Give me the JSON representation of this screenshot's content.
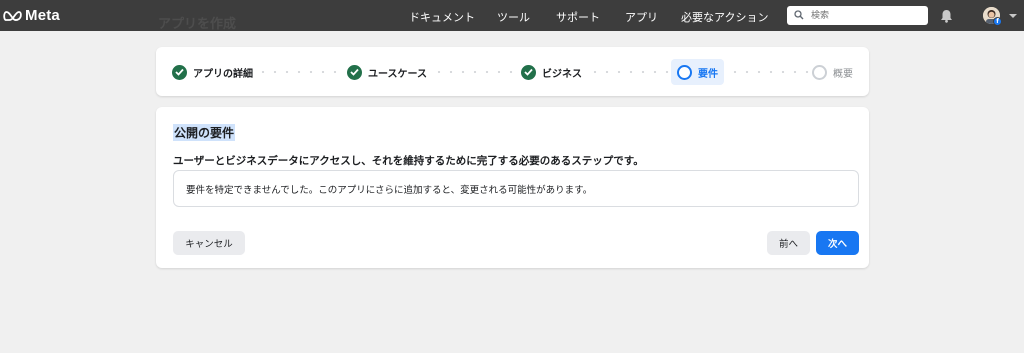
{
  "header": {
    "logo_text": "Meta",
    "nav": [
      {
        "label": "ドキュメント"
      },
      {
        "label": "ツール"
      },
      {
        "label": "サポート"
      },
      {
        "label": "アプリ"
      },
      {
        "label": "必要なアクション"
      }
    ],
    "search_placeholder": "検索",
    "icons": {
      "search": "search-icon",
      "notifications": "bell-icon",
      "account_menu": "chevron-down-icon"
    }
  },
  "page": {
    "background_title": "アプリを作成"
  },
  "stepper": {
    "steps": [
      {
        "label": "アプリの詳細",
        "state": "complete"
      },
      {
        "label": "ユースケース",
        "state": "complete"
      },
      {
        "label": "ビジネス",
        "state": "complete"
      },
      {
        "label": "要件",
        "state": "current"
      },
      {
        "label": "概要",
        "state": "upcoming"
      }
    ]
  },
  "main": {
    "title": "公開の要件",
    "description": "ユーザーとビジネスデータにアクセスし、それを維持するために完了する必要のあるステップです。",
    "notice": "要件を特定できませんでした。このアプリにさらに追加すると、変更される可能性があります。",
    "buttons": {
      "cancel": "キャンセル",
      "prev": "前へ",
      "next": "次へ"
    }
  },
  "colors": {
    "topbar": "#3d3d3d",
    "accent": "#1877f2",
    "complete": "#22704a"
  }
}
